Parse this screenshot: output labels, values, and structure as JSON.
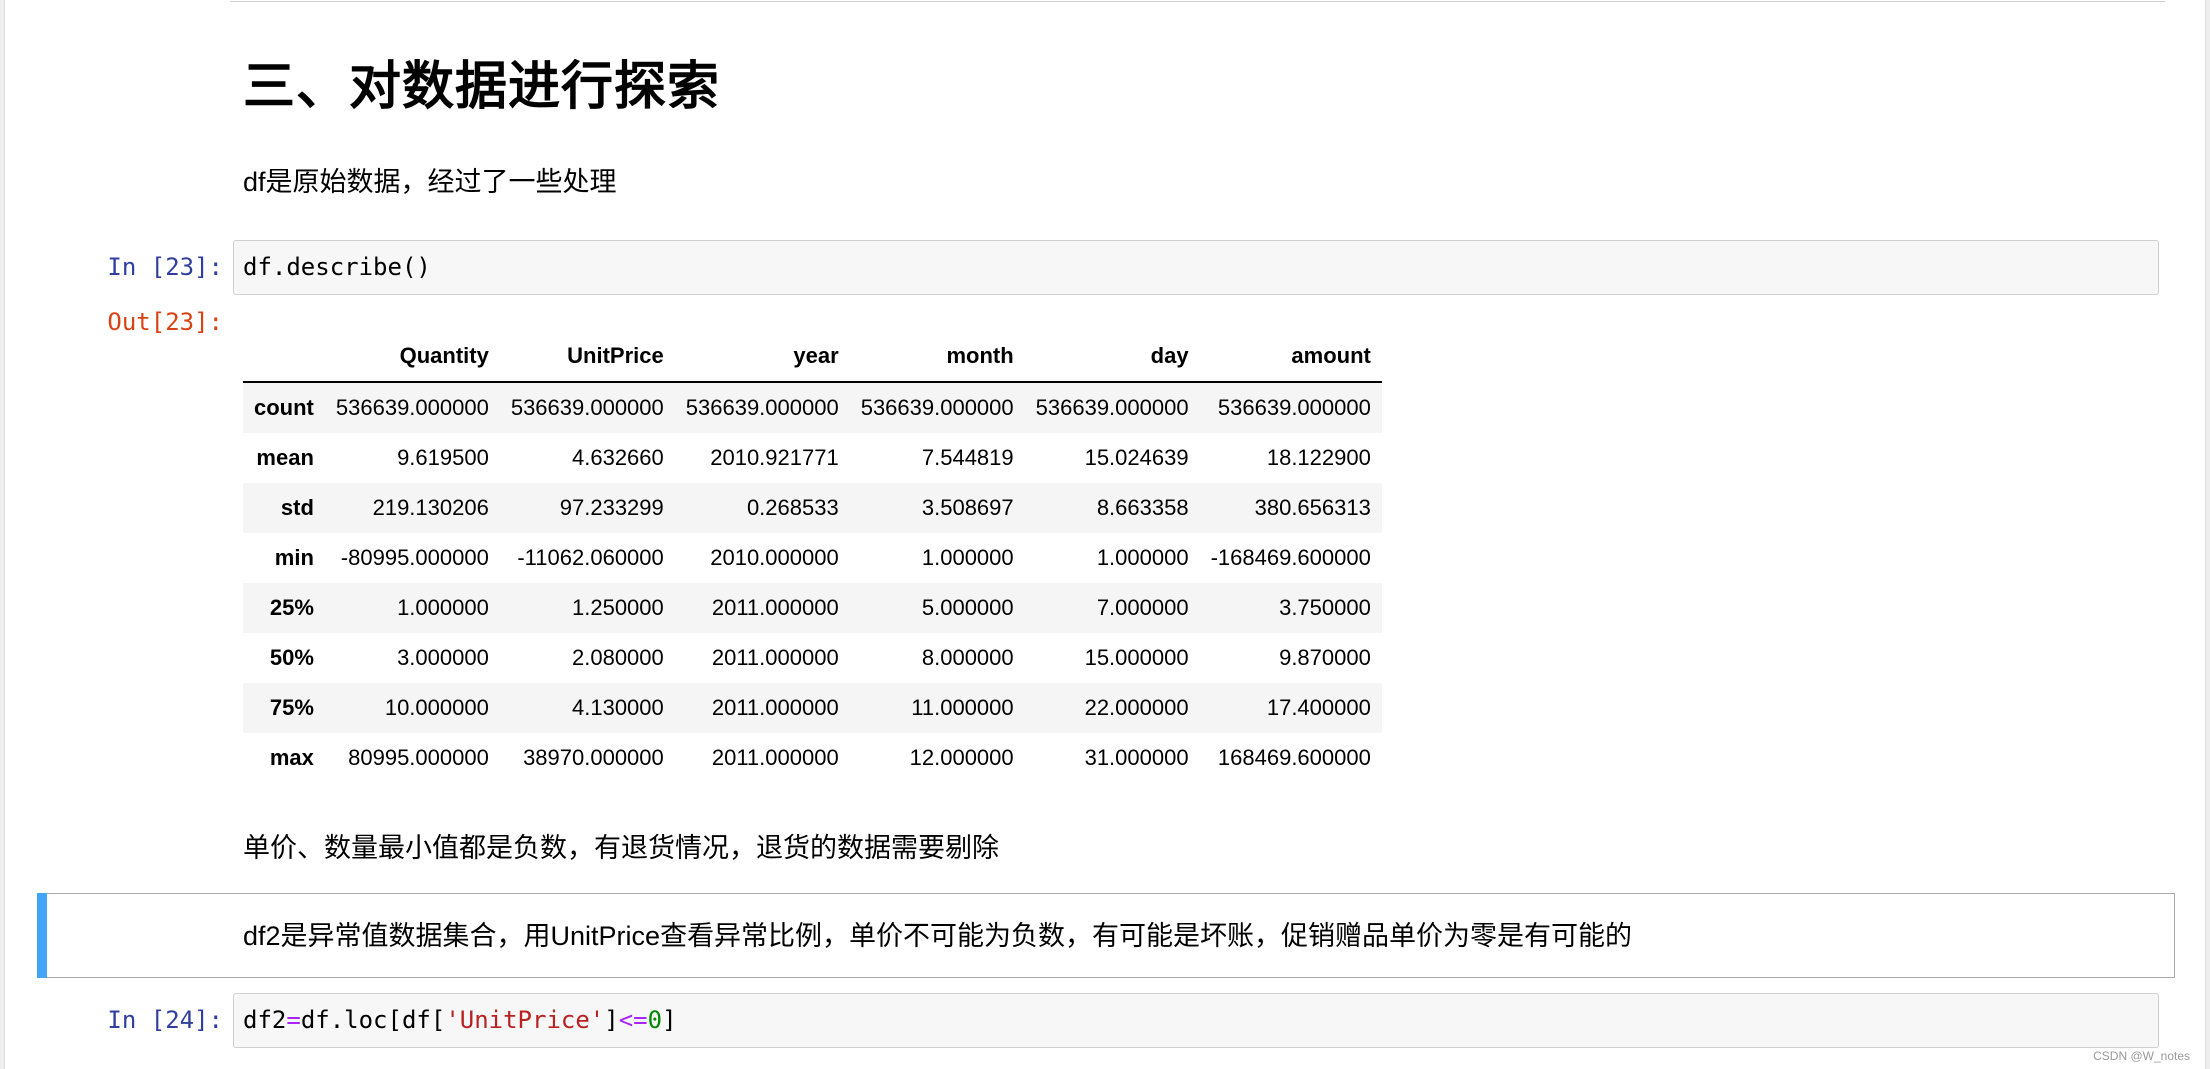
{
  "heading": "三、对数据进行探索",
  "intro_text": "df是原始数据，经过了一些处理",
  "cell23": {
    "in_prompt": "In  [23]:",
    "code": "df.describe()",
    "out_prompt": "Out[23]:"
  },
  "describe_table": {
    "columns": [
      "Quantity",
      "UnitPrice",
      "year",
      "month",
      "day",
      "amount"
    ],
    "rows": [
      {
        "label": "count",
        "values": [
          "536639.000000",
          "536639.000000",
          "536639.000000",
          "536639.000000",
          "536639.000000",
          "536639.000000"
        ]
      },
      {
        "label": "mean",
        "values": [
          "9.619500",
          "4.632660",
          "2010.921771",
          "7.544819",
          "15.024639",
          "18.122900"
        ]
      },
      {
        "label": "std",
        "values": [
          "219.130206",
          "97.233299",
          "0.268533",
          "3.508697",
          "8.663358",
          "380.656313"
        ]
      },
      {
        "label": "min",
        "values": [
          "-80995.000000",
          "-11062.060000",
          "2010.000000",
          "1.000000",
          "1.000000",
          "-168469.600000"
        ]
      },
      {
        "label": "25%",
        "values": [
          "1.000000",
          "1.250000",
          "2011.000000",
          "5.000000",
          "7.000000",
          "3.750000"
        ]
      },
      {
        "label": "50%",
        "values": [
          "3.000000",
          "2.080000",
          "2011.000000",
          "8.000000",
          "15.000000",
          "9.870000"
        ]
      },
      {
        "label": "75%",
        "values": [
          "10.000000",
          "4.130000",
          "2011.000000",
          "11.000000",
          "22.000000",
          "17.400000"
        ]
      },
      {
        "label": "max",
        "values": [
          "80995.000000",
          "38970.000000",
          "2011.000000",
          "12.000000",
          "31.000000",
          "168469.600000"
        ]
      }
    ]
  },
  "note_negative": "单价、数量最小值都是负数，有退货情况，退货的数据需要剔除",
  "note_df2": "df2是异常值数据集合，用UnitPrice查看异常比例，单价不可能为负数，有可能是坏账，促销赠品单价为零是有可能的",
  "cell24": {
    "in_prompt": "In  [24]:",
    "code_var": "df2",
    "code_eq": "=",
    "code_mid": "df.loc[df[",
    "code_str": "'UnitPrice'",
    "code_close": "]",
    "code_op": "<=",
    "code_num": "0",
    "code_end": "]"
  },
  "watermark": "CSDN @W_notes",
  "colors": {
    "in_prompt": "#303f9f",
    "out_prompt": "#d84315",
    "selected_bar": "#42a5f5"
  }
}
